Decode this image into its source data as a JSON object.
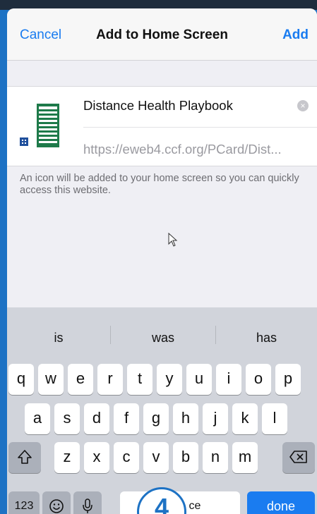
{
  "nav": {
    "cancel": "Cancel",
    "title": "Add to Home Screen",
    "add": "Add"
  },
  "bookmark": {
    "title": "Distance Health Playbook",
    "url": "https://eweb4.ccf.org/PCard/Dist...",
    "icon": "document-list-icon"
  },
  "info_text": "An icon will be added to your home screen so you can quickly access this website.",
  "keyboard": {
    "suggestions": [
      "is",
      "was",
      "has"
    ],
    "row1": [
      "q",
      "w",
      "e",
      "r",
      "t",
      "y",
      "u",
      "i",
      "o",
      "p"
    ],
    "row2": [
      "a",
      "s",
      "d",
      "f",
      "g",
      "h",
      "j",
      "k",
      "l"
    ],
    "row3": [
      "z",
      "x",
      "c",
      "v",
      "b",
      "n",
      "m"
    ],
    "numbers_key": "123",
    "space_partial": "ce",
    "done": "done"
  },
  "annotation": {
    "number": "4"
  },
  "colors": {
    "accent": "#1a7cf0",
    "frame": "#1d72c4"
  }
}
